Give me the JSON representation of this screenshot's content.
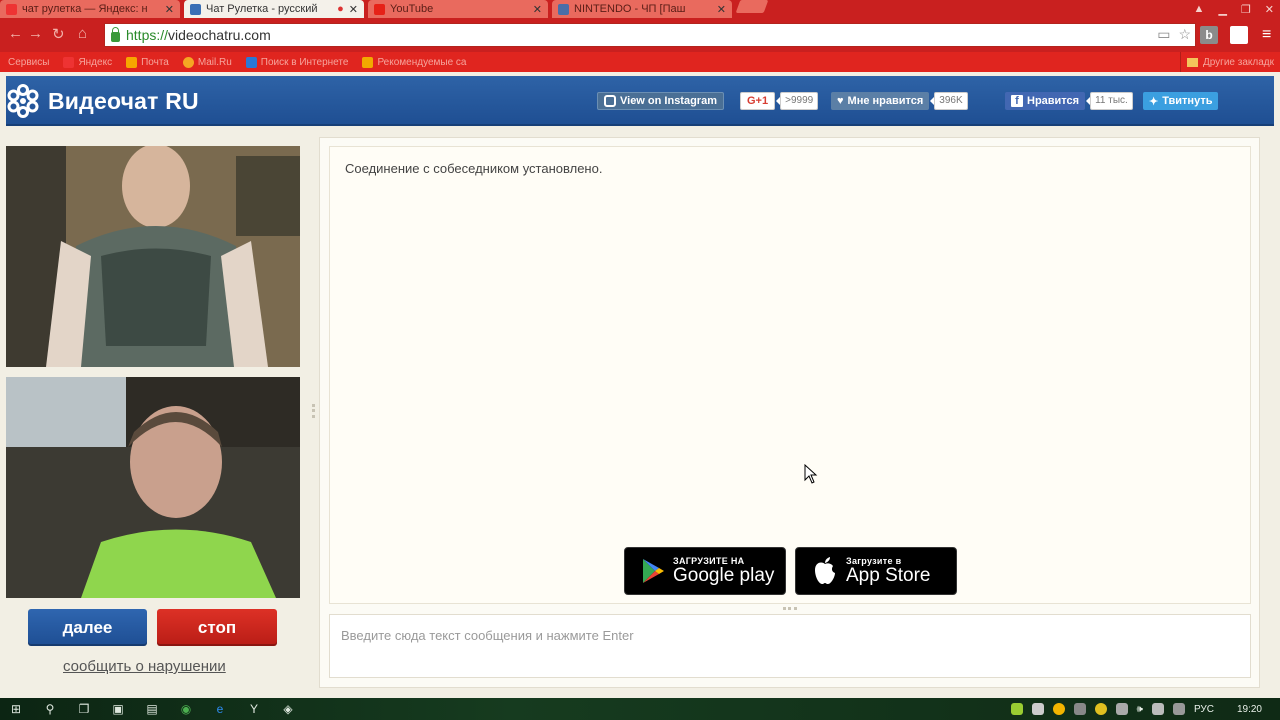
{
  "browser": {
    "tabs": [
      {
        "title": "чат рулетка — Яндекс: н",
        "active": false,
        "icon": "yandex-icon"
      },
      {
        "title": "Чат Рулетка - русский",
        "active": true,
        "icon": "snowflake-icon"
      },
      {
        "title": "YouTube",
        "active": false,
        "icon": "youtube-icon"
      },
      {
        "title": "NINTENDO - ЧП [Паш",
        "active": false,
        "icon": "pause-icon"
      }
    ],
    "url_scheme": "https://",
    "url_host": "videochatru.com",
    "ext_b_label": "b",
    "bookmarks": [
      "Сервисы",
      "Яндекс",
      "Почта",
      "Mail.Ru",
      "Поиск в Интернете",
      "Рекомендуемые са"
    ],
    "bookmarks_other": "Другие закладк"
  },
  "site": {
    "logo_text": "Видеочат RU",
    "instagram_label": "View on Instagram",
    "gplus_label": "G+1",
    "gplus_count": ">9999",
    "vk_label": "Мне нравится",
    "vk_count": "396K",
    "fb_label": "Нравится",
    "fb_count": "11 тыс.",
    "tw_label": "Твитнуть"
  },
  "controls": {
    "next_label": "далее",
    "stop_label": "стоп",
    "report_label": "сообщить о нарушении"
  },
  "chat": {
    "status_message": "Соединение с собеседником установлено.",
    "input_placeholder": "Введите сюда текст сообщения и нажмите Enter",
    "google_play_small": "ЗАГРУЗИТЕ НА",
    "google_play_big": "Google play",
    "app_store_small": "Загрузите в",
    "app_store_big": "App Store"
  },
  "taskbar": {
    "language": "РУС",
    "time": "19:20"
  },
  "colors": {
    "chrome_red": "#c9201f",
    "header_blue": "#2e63a7",
    "next_blue": "#2f66b0",
    "stop_red": "#dd3126"
  }
}
